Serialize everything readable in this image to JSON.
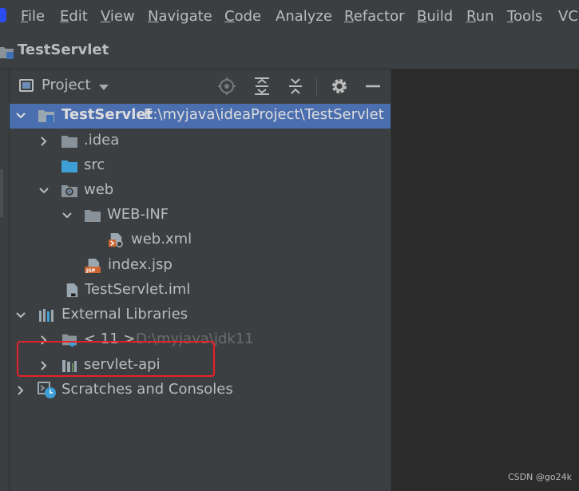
{
  "menu": [
    "File",
    "Edit",
    "View",
    "Navigate",
    "Code",
    "Analyze",
    "Refactor",
    "Build",
    "Run",
    "Tools",
    "VCS"
  ],
  "mnemonics": [
    "F",
    "E",
    "V",
    "N",
    "C",
    "",
    "R",
    "B",
    "R",
    "T",
    ""
  ],
  "title": "TestServlet",
  "toolwindow": {
    "title": "Project"
  },
  "tree": {
    "root": {
      "name": "TestServlet",
      "path": "E:\\myjava\\ideaProject\\TestServlet"
    },
    "idea": ".idea",
    "src": "src",
    "web": "web",
    "webinf": "WEB-INF",
    "webxml": "web.xml",
    "indexjsp": "index.jsp",
    "iml": "TestServlet.iml",
    "extlibs": "External Libraries",
    "jdk": {
      "name": "< 11 >",
      "path": "D:\\myjava\\jdk11"
    },
    "servletapi": "servlet-api",
    "scratches": "Scratches and Consoles"
  },
  "watermark": "CSDN @go24k",
  "colors": {
    "selection": "#4b6eaf",
    "folder": "#8a9299",
    "source_folder": "#3d9fd6",
    "highlight_box": "#e8202a"
  }
}
